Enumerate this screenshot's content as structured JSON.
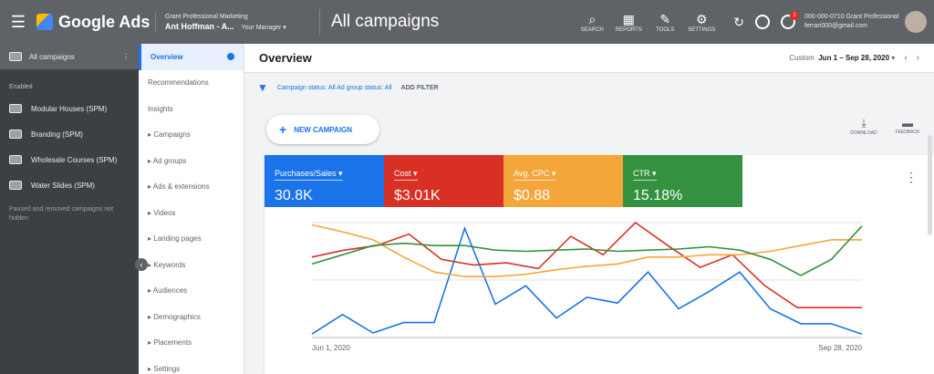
{
  "topbar": {
    "app_name": "Google Ads",
    "account_line1": "Grant Professional Marketing",
    "account_line2": "Ant Hoffman - A...",
    "account_line3": "Your Manager ▾",
    "page_title": "All campaigns",
    "tools": [
      {
        "icon": "search-icon",
        "label": "SEARCH"
      },
      {
        "icon": "reports-icon",
        "label": "REPORTS"
      },
      {
        "icon": "tools-icon",
        "label": "TOOLS"
      },
      {
        "icon": "settings-icon",
        "label": "SETTINGS"
      }
    ],
    "notif_count": "1",
    "user_line1": "000-000-0710 Grant Professional",
    "user_line2": "ferrari000@gmail.com"
  },
  "sidebar": {
    "header": "All campaigns",
    "section_label": "Enabled",
    "items": [
      {
        "label": "Modular Houses (SPM)"
      },
      {
        "label": "Branding (SPM)"
      },
      {
        "label": "Wholesale Courses (SPM)"
      },
      {
        "label": "Water Slides (SPM)"
      }
    ],
    "note": "Paused and removed campaigns not hidden"
  },
  "nav": {
    "items": [
      {
        "label": "Overview",
        "active": true
      },
      {
        "label": "Recommendations"
      },
      {
        "label": "Insights"
      },
      {
        "label": "▸ Campaigns"
      },
      {
        "label": "▸ Ad groups"
      },
      {
        "label": "▸ Ads & extensions"
      },
      {
        "label": "▸ Videos"
      },
      {
        "label": "▸ Landing pages"
      },
      {
        "label": "▸ Keywords"
      },
      {
        "label": "▸ Audiences"
      },
      {
        "label": "▸ Demographics"
      },
      {
        "label": "▸ Placements"
      },
      {
        "label": "▸ Settings"
      }
    ]
  },
  "main": {
    "title": "Overview",
    "date_prefix": "Custom",
    "date_range": "Jun 1 – Sep 28, 2020",
    "filter_text": "Campaign status: All  Ad group status: All",
    "add_filter": "ADD FILTER",
    "new_campaign": "NEW CAMPAIGN",
    "actions": [
      {
        "icon": "download-icon",
        "label": "DOWNLOAD"
      },
      {
        "icon": "feedback-icon",
        "label": "FEEDBACK"
      }
    ],
    "metrics": [
      {
        "label": "Purchases/Sales ▾",
        "value": "30.8K",
        "color": "#1a73e8"
      },
      {
        "label": "Cost ▾",
        "value": "$3.01K",
        "color": "#d93025"
      },
      {
        "label": "Avg. CPC ▾",
        "value": "$0.88",
        "color": "#f4a63a"
      },
      {
        "label": "CTR ▾",
        "value": "15.18%",
        "color": "#34913f"
      }
    ],
    "x_start": "Jun 1, 2020",
    "x_end": "Sep 28, 2020"
  },
  "chart_data": {
    "type": "line",
    "x_labels": [
      "Jun 1, 2020",
      "Sep 28, 2020"
    ],
    "series": [
      {
        "name": "Purchases/Sales",
        "color": "#1a73e8",
        "values": [
          0.03,
          0.2,
          0.04,
          0.13,
          0.13,
          0.95,
          0.29,
          0.45,
          0.17,
          0.35,
          0.3,
          0.57,
          0.25,
          0.4,
          0.57,
          0.25,
          0.12,
          0.12,
          0.03
        ]
      },
      {
        "name": "Cost",
        "color": "#d93025",
        "values": [
          0.7,
          0.76,
          0.8,
          0.9,
          0.68,
          0.63,
          0.65,
          0.6,
          0.88,
          0.72,
          1.0,
          0.8,
          0.61,
          0.72,
          0.45,
          0.26,
          0.26,
          0.26
        ]
      },
      {
        "name": "Avg. CPC",
        "color": "#f4a63a",
        "values": [
          0.98,
          0.92,
          0.85,
          0.7,
          0.57,
          0.53,
          0.53,
          0.55,
          0.59,
          0.62,
          0.64,
          0.7,
          0.7,
          0.72,
          0.72,
          0.75,
          0.8,
          0.85,
          0.85
        ]
      },
      {
        "name": "CTR",
        "color": "#34913f",
        "values": [
          0.64,
          0.72,
          0.8,
          0.82,
          0.8,
          0.8,
          0.76,
          0.75,
          0.76,
          0.77,
          0.75,
          0.76,
          0.77,
          0.79,
          0.76,
          0.68,
          0.54,
          0.68,
          0.97
        ]
      }
    ]
  }
}
